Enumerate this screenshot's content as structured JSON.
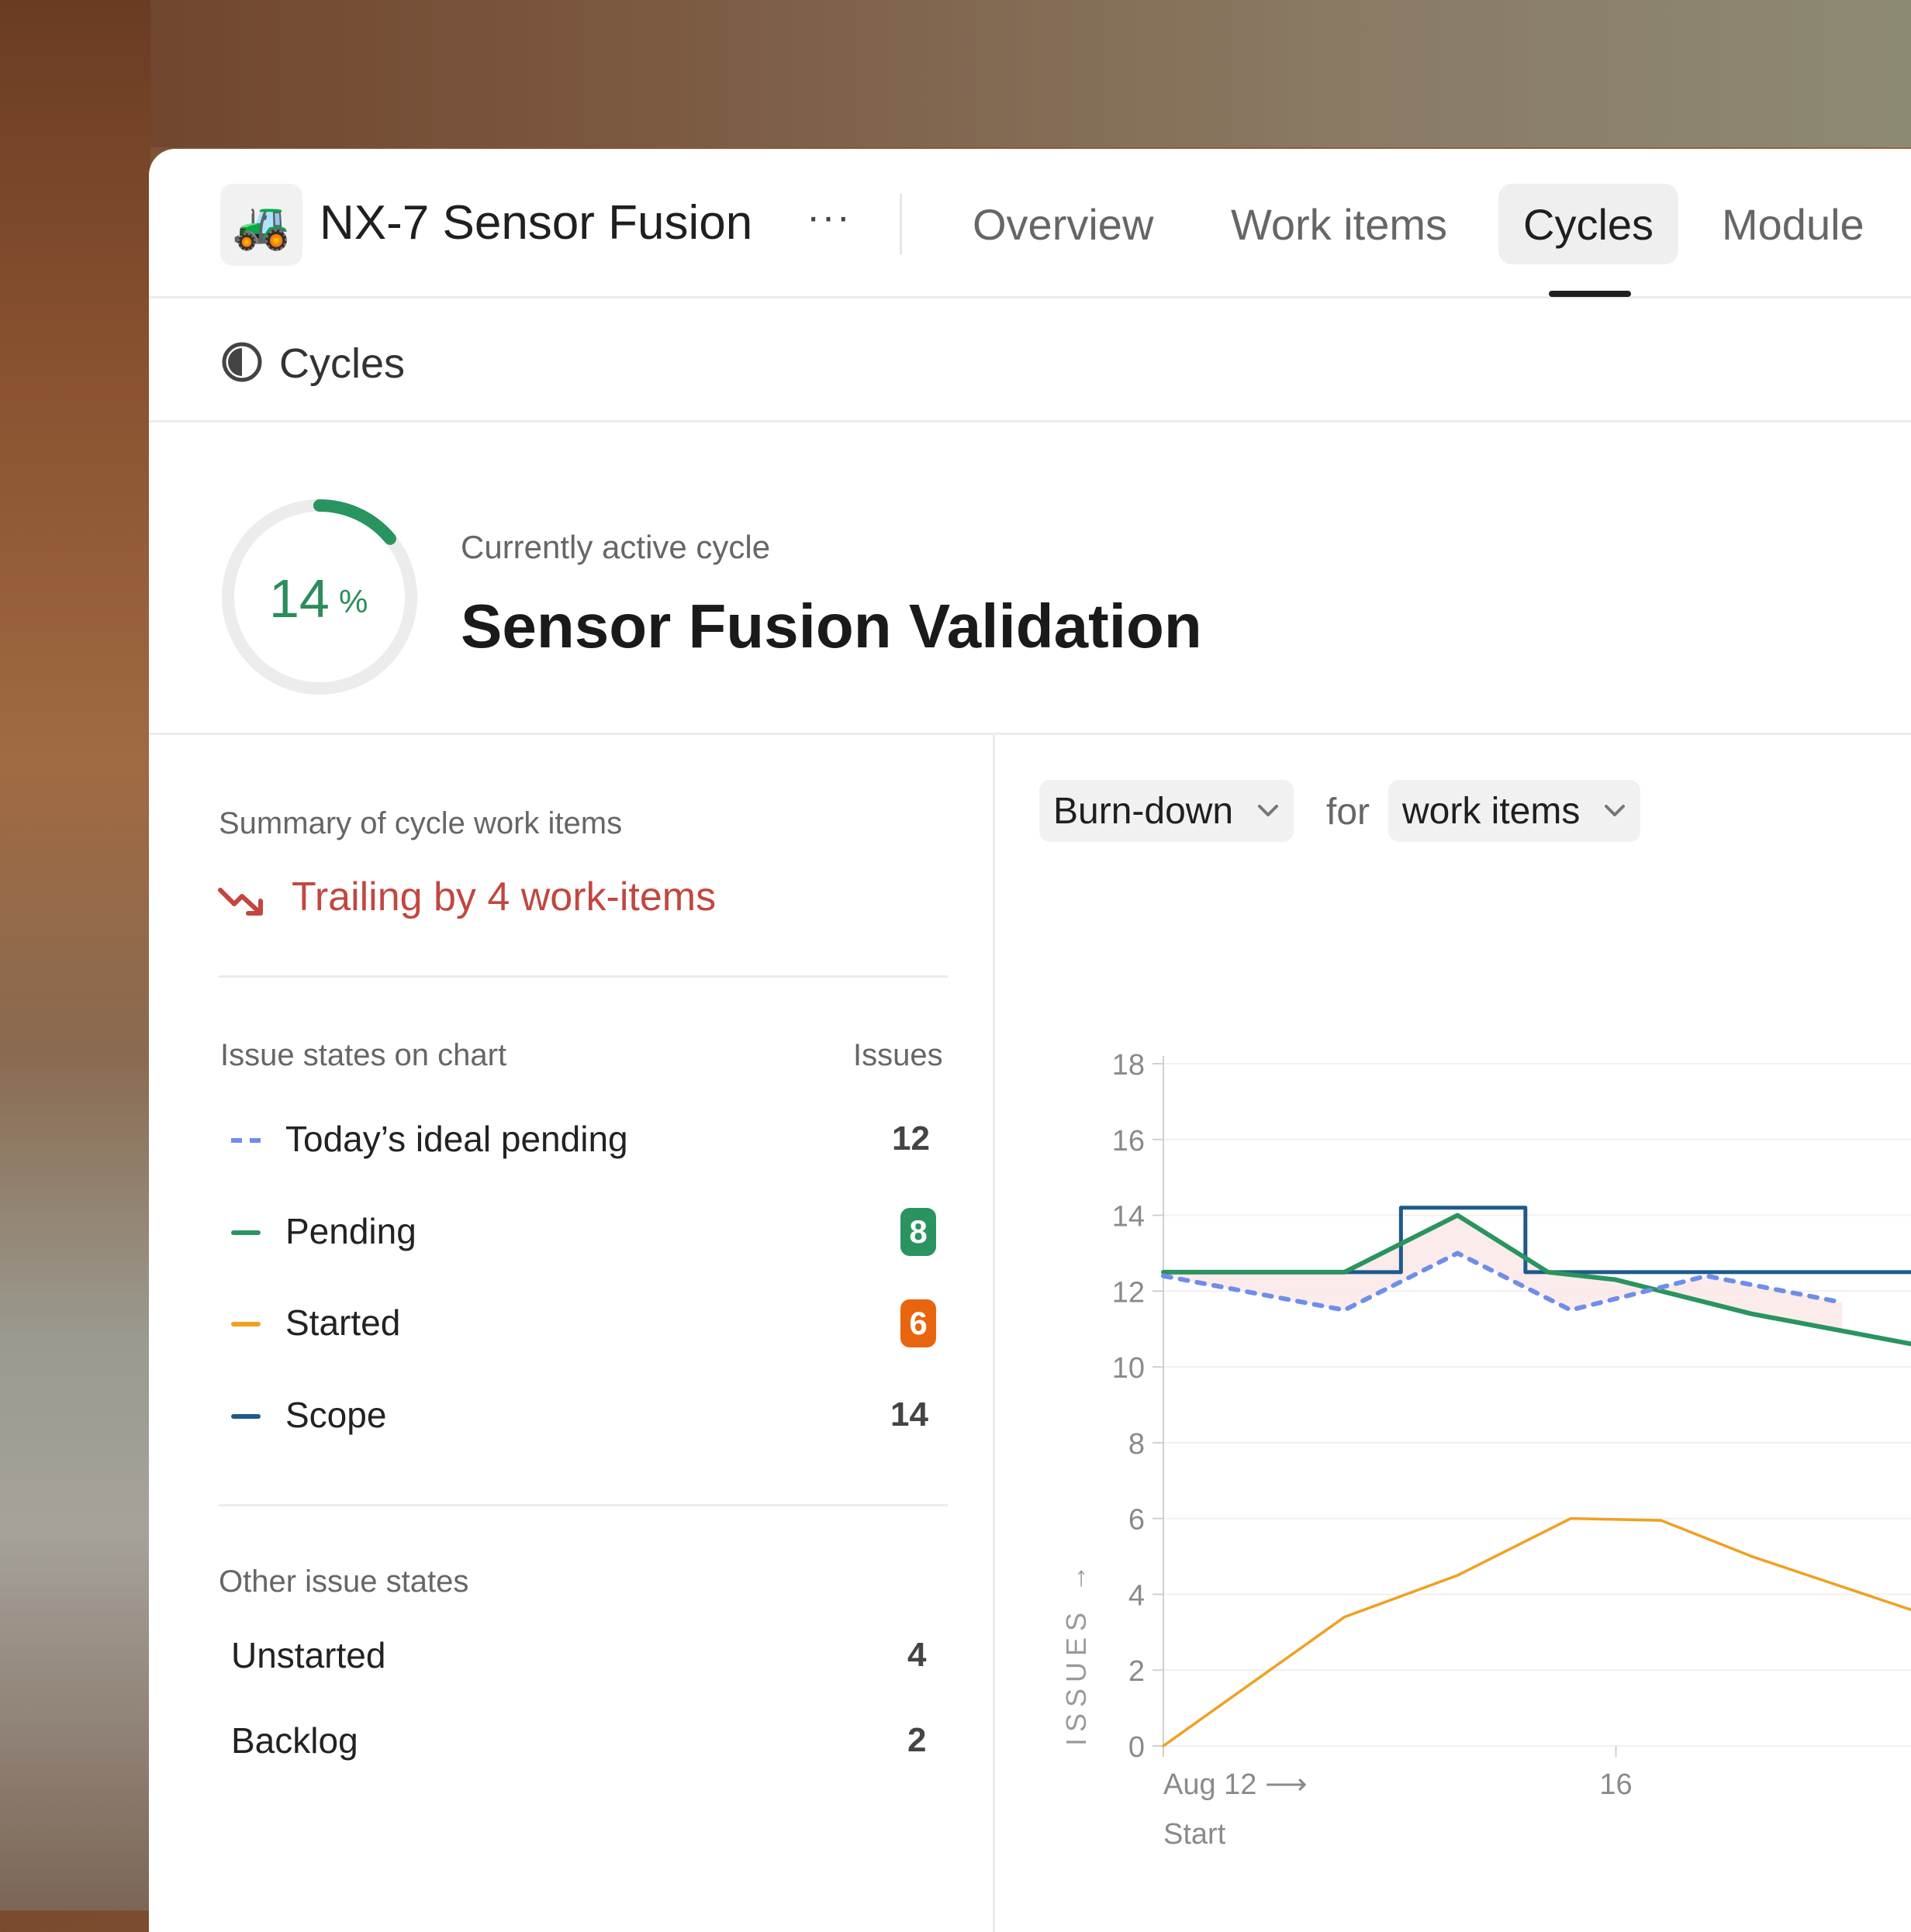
{
  "project": {
    "name": "NX-7 Sensor Fusion",
    "emoji": "🚜",
    "more": "···"
  },
  "tabs": [
    {
      "label": "Overview",
      "active": false
    },
    {
      "label": "Work items",
      "active": false
    },
    {
      "label": "Cycles",
      "active": true
    },
    {
      "label": "Module",
      "active": false
    }
  ],
  "section": {
    "title": "Cycles",
    "icon": "half-circle-icon"
  },
  "cycle": {
    "progress_percent": 14,
    "percent_number": "14",
    "percent_sign": "%",
    "label": "Currently active cycle",
    "name": "Sensor Fusion Validation"
  },
  "summary": {
    "heading": "Summary of cycle work items",
    "trailing_text": "Trailing by 4 work-items",
    "trailing_color": "#c2473f"
  },
  "legend": {
    "heading": "Issue states on chart",
    "count_heading": "Issues",
    "items": [
      {
        "label": "Today’s ideal pending",
        "count": "12",
        "color": "#6f8eea",
        "style": "dashed"
      },
      {
        "label": "Pending",
        "count": "8",
        "color": "#2a9460",
        "badge": true
      },
      {
        "label": "Started",
        "count": "6",
        "color": "#f0a020",
        "badge": true,
        "badge_color": "#e8650f"
      },
      {
        "label": "Scope",
        "count": "14",
        "color": "#1d5a8c"
      }
    ]
  },
  "other_states": {
    "heading": "Other issue states",
    "items": [
      {
        "label": "Unstarted",
        "count": "4"
      },
      {
        "label": "Backlog",
        "count": "2"
      }
    ]
  },
  "chart_controls": {
    "chart_type": "Burn-down",
    "for_word": "for",
    "metric": "work items"
  },
  "chart_data": {
    "type": "line",
    "ylabel": "ISSUES",
    "ylim": [
      0,
      18
    ],
    "yticks": [
      0,
      2,
      4,
      6,
      8,
      10,
      12,
      14,
      16,
      18
    ],
    "xlim": [
      12,
      18.8
    ],
    "xticks": [
      {
        "x": 12,
        "label": "Aug 12"
      },
      {
        "x": 16,
        "label": "16"
      }
    ],
    "x_start_label": "Start",
    "grid": true,
    "series": [
      {
        "name": "Scope",
        "color": "#1d5a8c",
        "style": "step",
        "x": [
          12,
          14.1,
          14.1,
          15.2,
          15.2,
          18.8
        ],
        "y": [
          12.5,
          12.5,
          14.2,
          14.2,
          12.5,
          12.5
        ]
      },
      {
        "name": "Pending",
        "color": "#2a9460",
        "style": "solid",
        "x": [
          12,
          13.6,
          14.6,
          15.4,
          16.0,
          17.2,
          18.8
        ],
        "y": [
          12.5,
          12.5,
          14.0,
          12.5,
          12.3,
          11.4,
          10.5
        ]
      },
      {
        "name": "Today’s ideal pending",
        "color": "#6f8eea",
        "style": "dashed",
        "x": [
          12,
          13.6,
          14.6,
          15.6,
          16.8,
          18.0
        ],
        "y": [
          12.4,
          11.5,
          13.0,
          11.5,
          12.4,
          11.7
        ]
      },
      {
        "name": "Started",
        "color": "#f0a020",
        "style": "solid",
        "x": [
          12,
          13.6,
          14.6,
          15.6,
          16.4,
          17.2,
          18.8
        ],
        "y": [
          0,
          3.4,
          4.5,
          6.0,
          5.95,
          5.0,
          3.4
        ]
      }
    ]
  }
}
